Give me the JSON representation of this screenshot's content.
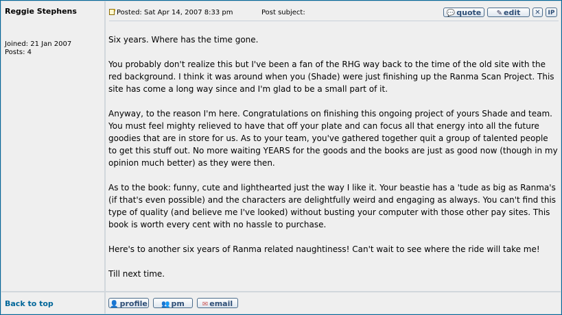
{
  "author": {
    "name": "Reggie Stephens",
    "joined": "Joined: 21 Jan 2007",
    "posts": "Posts: 4"
  },
  "post": {
    "posted": "Posted: Sat Apr 14, 2007 8:33 pm",
    "subject": "Post subject:",
    "buttons": {
      "quote": "quote",
      "edit": "edit",
      "delete": "✕",
      "ip": "IP"
    },
    "paragraphs": [
      "Six years. Where has the time gone.",
      "You probably don't realize this but I've been a fan of the RHG way back to the time of the old site with the red background. I think it was around when you (Shade) were just finishing up the Ranma Scan Project. This site has come a long way since and I'm glad to be a small part of it.",
      "Anyway, to the reason I'm here. Congratulations on finishing this ongoing project of yours Shade and team. You must feel mighty relieved to have that off your plate and can focus all that energy into all the future goodies that are in store for us. As to your team, you've gathered together quit a group of talented people to get this stuff out. No more waiting YEARS for the goods and the books are just as good now (though in my opinion much better) as they were then.",
      "As to the book: funny, cute and lighthearted just the way I like it. Your beastie has a 'tude as big as Ranma's (if that's even possible) and the characters are delightfully weird and engaging as always. You can't find this type of quality (and believe me I've looked) without busting your computer with those other pay sites. This book is worth every cent with no hassle to purchase.",
      "Here's to another six years of Ranma related naughtiness! Can't wait to see where the ride will take me!",
      "Till next time."
    ]
  },
  "footer": {
    "back_to_top": "Back to top",
    "profile": "profile",
    "pm": "pm",
    "email": "email"
  }
}
